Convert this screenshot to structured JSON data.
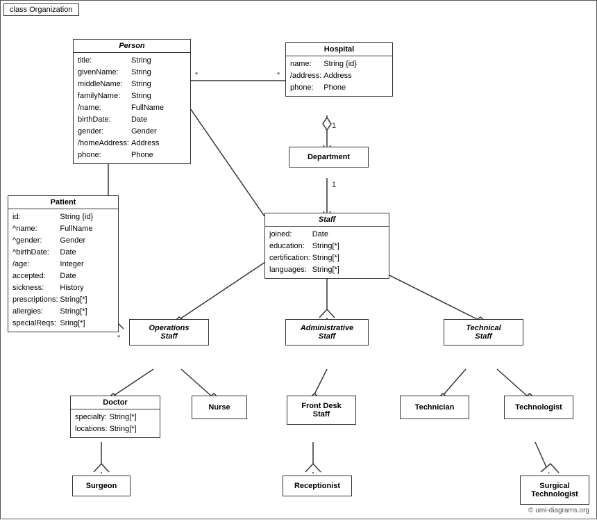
{
  "diagram": {
    "title": "class Organization",
    "copyright": "© uml-diagrams.org"
  },
  "classes": {
    "person": {
      "title": "Person",
      "italic": true,
      "attrs": [
        [
          "title:",
          "String"
        ],
        [
          "givenName:",
          "String"
        ],
        [
          "middleName:",
          "String"
        ],
        [
          "familyName:",
          "String"
        ],
        [
          "/name:",
          "FullName"
        ],
        [
          "birthDate:",
          "Date"
        ],
        [
          "gender:",
          "Gender"
        ],
        [
          "/homeAddress:",
          "Address"
        ],
        [
          "phone:",
          "Phone"
        ]
      ]
    },
    "hospital": {
      "title": "Hospital",
      "attrs": [
        [
          "name:",
          "String {id}"
        ],
        [
          "/address:",
          "Address"
        ],
        [
          "phone:",
          "Phone"
        ]
      ]
    },
    "patient": {
      "title": "Patient",
      "attrs": [
        [
          "id:",
          "String {id}"
        ],
        [
          "^name:",
          "FullName"
        ],
        [
          "^gender:",
          "Gender"
        ],
        [
          "^birthDate:",
          "Date"
        ],
        [
          "/age:",
          "Integer"
        ],
        [
          "accepted:",
          "Date"
        ],
        [
          "sickness:",
          "History"
        ],
        [
          "prescriptions:",
          "String[*]"
        ],
        [
          "allergies:",
          "String[*]"
        ],
        [
          "specialReqs:",
          "Sring[*]"
        ]
      ]
    },
    "department": {
      "title": "Department"
    },
    "staff": {
      "title": "Staff",
      "italic": true,
      "attrs": [
        [
          "joined:",
          "Date"
        ],
        [
          "education:",
          "String[*]"
        ],
        [
          "certification:",
          "String[*]"
        ],
        [
          "languages:",
          "String[*]"
        ]
      ]
    },
    "operationsStaff": {
      "title": "Operations Staff",
      "italic": true
    },
    "administrativeStaff": {
      "title": "Administrative Staff",
      "italic": true
    },
    "technicalStaff": {
      "title": "Technical Staff",
      "italic": true
    },
    "doctor": {
      "title": "Doctor",
      "attrs": [
        [
          "specialty:",
          "String[*]"
        ],
        [
          "locations:",
          "String[*]"
        ]
      ]
    },
    "nurse": {
      "title": "Nurse"
    },
    "frontDeskStaff": {
      "title": "Front Desk Staff"
    },
    "technician": {
      "title": "Technician"
    },
    "technologist": {
      "title": "Technologist"
    },
    "surgeon": {
      "title": "Surgeon"
    },
    "receptionist": {
      "title": "Receptionist"
    },
    "surgicalTechnologist": {
      "title": "Surgical Technologist"
    }
  }
}
